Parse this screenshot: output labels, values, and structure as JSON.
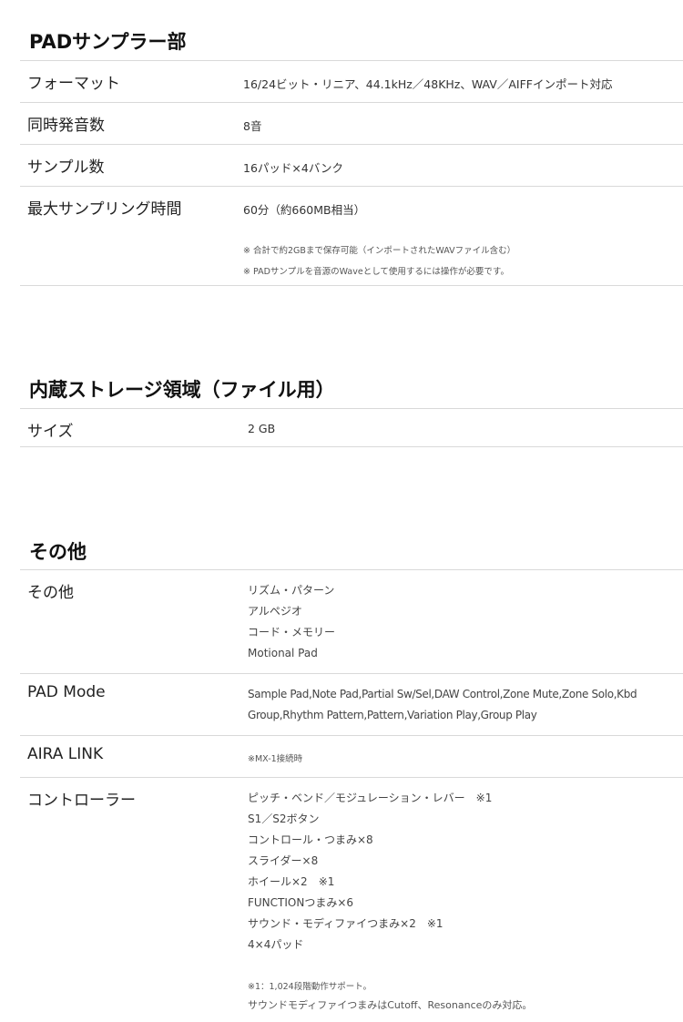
{
  "pad_sampler": {
    "title": "PADサンプラー部",
    "rows": [
      {
        "label": "フォーマット",
        "value": "16/24ビット・リニア、44.1kHz／48KHz、WAV／AIFFインポート対応"
      },
      {
        "label": "同時発音数",
        "value": "8音"
      },
      {
        "label": "サンプル数",
        "value": "16パッド×4バンク"
      },
      {
        "label": "最大サンプリング時間",
        "value": "60分（約660MB相当）",
        "notes": [
          "※ 合計で約2GBまで保存可能（インポートされたWAVファイル含む）",
          "※ PADサンプルを音源のWaveとして使用するには操作が必要です。"
        ]
      }
    ]
  },
  "storage": {
    "title": "内蔵ストレージ領域（ファイル用）",
    "rows": [
      {
        "label": "サイズ",
        "value": "2 GB"
      }
    ]
  },
  "other": {
    "title": "その他",
    "rows": [
      {
        "label": "その他",
        "lines": [
          "リズム・パターン",
          "アルペジオ",
          "コード・メモリー",
          "Motional Pad"
        ]
      },
      {
        "label": "PAD Mode",
        "lines": [
          "Sample Pad,Note Pad,Partial Sw/Sel,DAW Control,Zone Mute,Zone Solo,Kbd",
          "Group,Rhythm Pattern,Pattern,Variation Play,Group Play"
        ]
      },
      {
        "label": "AIRA LINK",
        "note": "※MX-1接続時"
      },
      {
        "label": "コントローラー",
        "lines": [
          "ピッチ・ベンド／モジュレーション・レバー　※1",
          "S1／S2ボタン",
          "コントロール・つまみ×8",
          "スライダー×8",
          "ホイール×2　※1",
          "FUNCTIONつまみ×6",
          "サウンド・モディファイつまみ×2　※1",
          "4×4パッド"
        ],
        "notes": [
          "※1：1,024段階動作サポート。",
          "サウンドモディファイつまみはCutoff、Resonanceのみ対応。"
        ]
      }
    ]
  }
}
